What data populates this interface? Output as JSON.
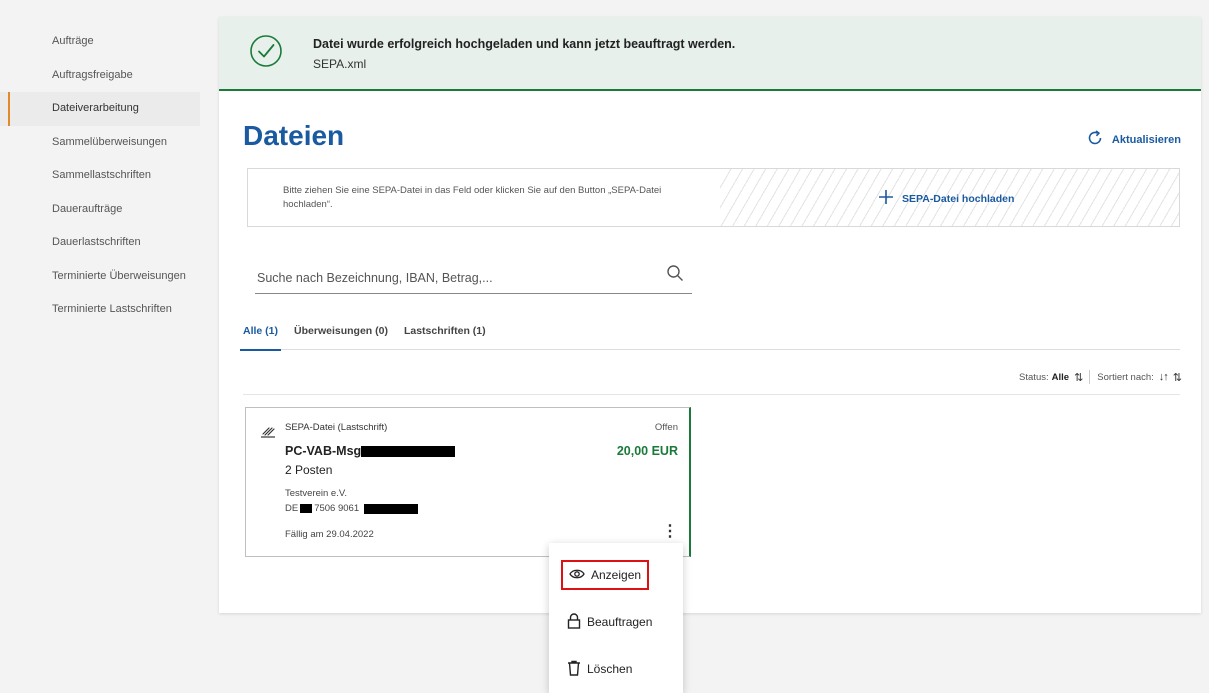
{
  "sidebar": {
    "items": [
      {
        "label": "Aufträge"
      },
      {
        "label": "Auftragsfreigabe"
      },
      {
        "label": "Dateiverarbeitung",
        "active": true
      },
      {
        "label": "Sammelüberweisungen"
      },
      {
        "label": "Sammellastschriften"
      },
      {
        "label": "Daueraufträge"
      },
      {
        "label": "Dauerlastschriften"
      },
      {
        "label": "Terminierte Überweisungen"
      },
      {
        "label": "Terminierte Lastschriften"
      }
    ]
  },
  "alert": {
    "title": "Datei wurde erfolgreich hochgeladen und kann jetzt beauftragt werden.",
    "filename": "SEPA.xml",
    "icon": "check-circle-icon"
  },
  "page": {
    "title": "Dateien",
    "refresh_label": "Aktualisieren"
  },
  "upload": {
    "hint": "Bitte ziehen Sie eine SEPA-Datei in das Feld oder klicken Sie auf den Button „SEPA-Datei hochladen“.",
    "button_label": "SEPA-Datei hochladen"
  },
  "search": {
    "placeholder": "Suche nach Bezeichnung, IBAN, Betrag,..."
  },
  "tabs": [
    {
      "label": "Alle (1)",
      "active": true
    },
    {
      "label": "Überweisungen (0)"
    },
    {
      "label": "Lastschriften (1)"
    }
  ],
  "sortbar": {
    "status_label": "Status:",
    "status_value": "Alle",
    "sort_label": "Sortiert nach:"
  },
  "card": {
    "type": "SEPA-Datei (Lastschrift)",
    "status": "Offen",
    "name": "PC-VAB-Msg",
    "amount": "20,00 EUR",
    "posten": "2 Posten",
    "holder": "Testverein e.V.",
    "iban_prefix": "DE",
    "iban_middle": "7506 9061",
    "due": "Fällig am 29.04.2022"
  },
  "menu": {
    "items": [
      {
        "label": "Anzeigen",
        "icon": "eye-icon"
      },
      {
        "label": "Beauftragen",
        "icon": "lock-icon"
      },
      {
        "label": "Löschen",
        "icon": "trash-icon"
      }
    ]
  },
  "colors": {
    "brand_blue": "#1a5aa0",
    "success_green": "#1a7a3a",
    "active_marker": "#e08a2c",
    "highlight_red": "#dd1111"
  }
}
